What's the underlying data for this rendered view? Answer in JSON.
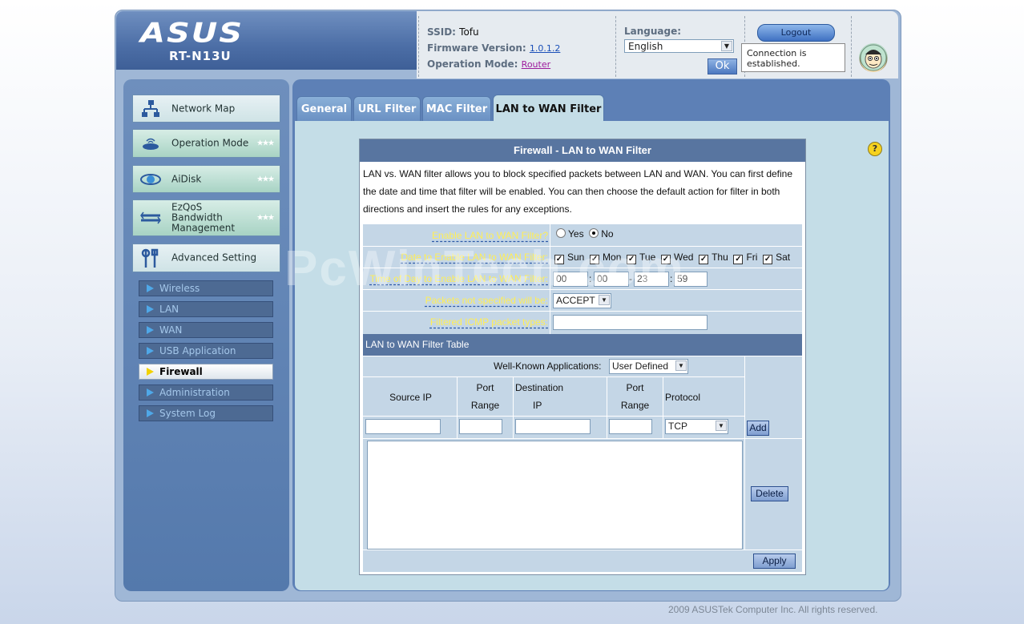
{
  "header": {
    "logo": "ASUS",
    "model": "RT-N13U",
    "ssid_label": "SSID:",
    "ssid_value": "Tofu",
    "firmware_label": "Firmware Version:",
    "firmware_value": "1.0.1.2",
    "opmode_label": "Operation Mode:",
    "opmode_value": "Router",
    "language_label": "Language:",
    "language_value": "English",
    "ok_label": "Ok",
    "logout_label": "Logout",
    "connection_status": "Connection is established."
  },
  "sidebar": {
    "main_items": [
      {
        "label": "Network Map",
        "icon": "network-map-icon"
      },
      {
        "label": "Operation Mode",
        "icon": "router-icon"
      },
      {
        "label": "AiDisk",
        "icon": "disk-icon"
      },
      {
        "label": "EzQoS Bandwidth Management",
        "icon": "bandwidth-icon"
      },
      {
        "label": "Advanced Setting",
        "icon": "tools-icon"
      }
    ],
    "sub_items": [
      {
        "label": "Wireless"
      },
      {
        "label": "LAN"
      },
      {
        "label": "WAN"
      },
      {
        "label": "USB Application"
      },
      {
        "label": "Firewall",
        "active": true
      },
      {
        "label": "Administration"
      },
      {
        "label": "System Log"
      }
    ]
  },
  "tabs": [
    {
      "label": "General"
    },
    {
      "label": "URL Filter"
    },
    {
      "label": "MAC Filter"
    },
    {
      "label": "LAN to WAN Filter",
      "active": true
    }
  ],
  "panel": {
    "title": "Firewall - LAN to WAN Filter",
    "description": "LAN vs. WAN filter allows you to block specified packets between LAN and WAN. You can first define the date and time that filter will be enabled. You can then choose the default action for filter in both directions and insert the rules for any exceptions.",
    "fields": {
      "enable_label": "Enable LAN to WAN Filter?",
      "enable_yes": "Yes",
      "enable_no": "No",
      "date_label": "Date to Enable LAN to WAN Filter:",
      "days": [
        "Sun",
        "Mon",
        "Tue",
        "Wed",
        "Thu",
        "Fri",
        "Sat"
      ],
      "time_label": "Time of Day to Enable LAN to WAN Filter:",
      "time_start_h": "00",
      "time_start_m": "00",
      "time_end_h": "23",
      "time_end_m": "59",
      "packets_label": "Packets not specified will be:",
      "packets_value": "ACCEPT",
      "icmp_label": "Filtered ICMP packet types:",
      "icmp_value": ""
    },
    "table": {
      "title": "LAN to WAN Filter Table",
      "well_known_label": "Well-Known Applications:",
      "well_known_value": "User Defined",
      "col_source_ip": "Source IP",
      "col_port_range_1a": "Port",
      "col_port_range_1b": "Range",
      "col_dest_ip_a": "Destination",
      "col_dest_ip_b": "IP",
      "col_port_range_2a": "Port",
      "col_port_range_2b": "Range",
      "col_protocol": "Protocol",
      "protocol_value": "TCP",
      "add_label": "Add",
      "delete_label": "Delete",
      "apply_label": "Apply"
    }
  },
  "footer": "2009 ASUSTek Computer Inc. All rights reserved.",
  "watermark": "PcWinTech.com",
  "colors": {
    "header_blue": "#4c6ea6",
    "panel_title": "#5875a0",
    "field_label": "#ffee56",
    "content_bg": "#c4dde7"
  }
}
